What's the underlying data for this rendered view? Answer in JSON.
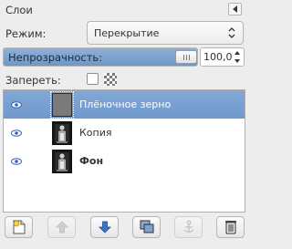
{
  "panel": {
    "title": "Слои"
  },
  "mode": {
    "label": "Режим:",
    "value": "Перекрытие"
  },
  "opacity": {
    "label": "Непрозрачность:",
    "value": "100,0",
    "level_percent": 100
  },
  "lock": {
    "label": "Запереть:",
    "checked": false
  },
  "layers": [
    {
      "name": "Плёночное зерно",
      "visible": true,
      "selected": true,
      "bold": false,
      "thumb": "grey-fill"
    },
    {
      "name": "Копия",
      "visible": true,
      "selected": false,
      "bold": false,
      "thumb": "statue-photo"
    },
    {
      "name": "Фон",
      "visible": true,
      "selected": false,
      "bold": true,
      "thumb": "statue-photo"
    }
  ],
  "toolbar": {
    "buttons": [
      {
        "icon": "new-layer-icon",
        "enabled": true
      },
      {
        "icon": "raise-layer-icon",
        "enabled": false
      },
      {
        "icon": "lower-layer-icon",
        "enabled": true
      },
      {
        "icon": "duplicate-layer-icon",
        "enabled": true
      },
      {
        "icon": "anchor-icon",
        "enabled": false
      },
      {
        "icon": "delete-layer-icon",
        "enabled": true
      }
    ]
  },
  "colors": {
    "selection": "#7aa0d0",
    "accent_blue": "#2f65b8",
    "background": "#ededed"
  }
}
